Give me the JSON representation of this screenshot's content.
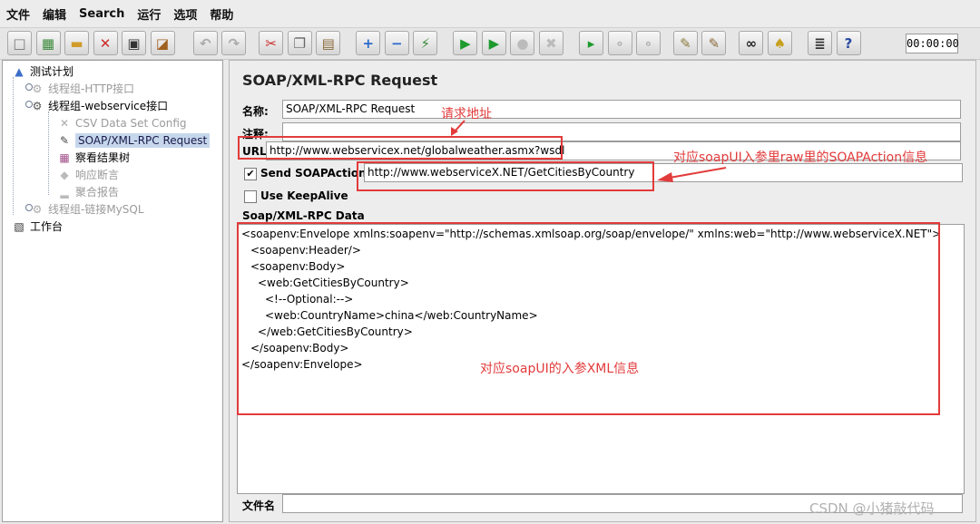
{
  "menu": [
    "文件",
    "编辑",
    "Search",
    "运行",
    "选项",
    "帮助"
  ],
  "toolbar": {
    "timer": "00:00:00",
    "buttons": [
      {
        "icon": "new-icon",
        "glyph": "□",
        "color": "#777"
      },
      {
        "icon": "templates-icon",
        "glyph": "▦",
        "color": "#3b8a3b"
      },
      {
        "icon": "open-icon",
        "glyph": "▬",
        "color": "#d19b2a"
      },
      {
        "icon": "close-file-icon",
        "glyph": "✕",
        "color": "#cc2a2a"
      },
      {
        "icon": "save-icon",
        "glyph": "▣",
        "color": "#333"
      },
      {
        "icon": "save-as-icon",
        "glyph": "◪",
        "color": "#a06020"
      },
      {
        "icon": "undo-icon",
        "glyph": "↶",
        "color": "#aaa"
      },
      {
        "icon": "redo-icon",
        "glyph": "↷",
        "color": "#aaa"
      },
      {
        "icon": "cut-icon",
        "glyph": "✂",
        "color": "#cc2a2a"
      },
      {
        "icon": "copy-icon",
        "glyph": "❐",
        "color": "#666"
      },
      {
        "icon": "paste-icon",
        "glyph": "▤",
        "color": "#8a6a3a"
      },
      {
        "icon": "expand-icon",
        "glyph": "+",
        "color": "#2a6acc"
      },
      {
        "icon": "collapse-icon",
        "glyph": "−",
        "color": "#2a6acc"
      },
      {
        "icon": "toggle-icon",
        "glyph": "⚡",
        "color": "#3b8a3b"
      },
      {
        "icon": "start-icon",
        "glyph": "▶",
        "color": "#1e9a2e"
      },
      {
        "icon": "start-no-pause-icon",
        "glyph": "▶",
        "color": "#1e9a2e"
      },
      {
        "icon": "stop-icon",
        "glyph": "●",
        "color": "#bbb"
      },
      {
        "icon": "shutdown-icon",
        "glyph": "✖",
        "color": "#bbb"
      },
      {
        "icon": "remote-start-icon",
        "glyph": "▸",
        "color": "#1e9a2e"
      },
      {
        "icon": "remote-stop-icon",
        "glyph": "∘",
        "color": "#aaa"
      },
      {
        "icon": "remote-shutdown-icon",
        "glyph": "∘",
        "color": "#aaa"
      },
      {
        "icon": "clear-icon",
        "glyph": "✎",
        "color": "#8a7a3a"
      },
      {
        "icon": "clear-all-icon",
        "glyph": "✎",
        "color": "#8a6a3a"
      },
      {
        "icon": "search-icon",
        "glyph": "∞",
        "color": "#222"
      },
      {
        "icon": "reset-search-icon",
        "glyph": "♠",
        "color": "#c8a020"
      },
      {
        "icon": "function-helper-icon",
        "glyph": "≣",
        "color": "#333"
      },
      {
        "icon": "help-icon",
        "glyph": "?",
        "color": "#2a4aa0"
      }
    ]
  },
  "tree": {
    "nodes": [
      {
        "label": "测试计划",
        "icon": "test-plan-icon",
        "glyph": "▲",
        "color": "#3b6ec8",
        "dim": false,
        "selected": false
      },
      {
        "label": "线程组-HTTP接口",
        "icon": "thread-group-icon",
        "glyph": "⚙",
        "color": "#aaa",
        "dim": true,
        "selected": false
      },
      {
        "label": "线程组-webservice接口",
        "icon": "thread-group-icon",
        "glyph": "⚙",
        "color": "#555",
        "dim": false,
        "selected": false
      },
      {
        "label": "CSV Data Set Config",
        "icon": "config-tools-icon",
        "glyph": "✕",
        "color": "#aaa",
        "dim": true,
        "selected": false
      },
      {
        "label": "SOAP/XML-RPC Request",
        "icon": "soap-sampler-icon",
        "glyph": "✎",
        "color": "#444",
        "dim": false,
        "selected": true
      },
      {
        "label": "察看结果树",
        "icon": "results-tree-icon",
        "glyph": "▦",
        "color": "#a0508a",
        "dim": false,
        "selected": false
      },
      {
        "label": "响应断言",
        "icon": "assertion-icon",
        "glyph": "◆",
        "color": "#bbb",
        "dim": true,
        "selected": false
      },
      {
        "label": "聚合报告",
        "icon": "aggregate-report-icon",
        "glyph": "▂",
        "color": "#bbb",
        "dim": true,
        "selected": false
      },
      {
        "label": "线程组-链接MySQL",
        "icon": "thread-group-icon",
        "glyph": "⚙",
        "color": "#aaa",
        "dim": true,
        "selected": false
      },
      {
        "label": "工作台",
        "icon": "workbench-icon",
        "glyph": "▧",
        "color": "#333",
        "dim": false,
        "selected": false
      }
    ]
  },
  "panel": {
    "title": "SOAP/XML-RPC Request",
    "name_label": "名称:",
    "name_value": "SOAP/XML-RPC Request",
    "comment_label": "注释:",
    "comment_value": "",
    "url_label": "URL",
    "url_value": "http://www.webservicex.net/globalweather.asmx?wsdl",
    "send_soapaction_label": "Send SOAPAction:",
    "send_soapaction_checked": "✔",
    "soapaction_value": "http://www.webserviceX.NET/GetCitiesByCountry",
    "keepalive_label": "Use KeepAlive",
    "keepalive_checked": "",
    "data_label": "Soap/XML-RPC Data",
    "xml_lines": [
      "<soapenv:Envelope xmlns:soapenv=\"http://schemas.xmlsoap.org/soap/envelope/\" xmlns:web=\"http://www.webserviceX.NET\">",
      "<soapenv:Header/>",
      "<soapenv:Body>",
      "<web:GetCitiesByCountry>",
      "<!--Optional:-->",
      "<web:CountryName>china</web:CountryName>",
      "</web:GetCitiesByCountry>",
      "</soapenv:Body>",
      "</soapenv:Envelope>"
    ],
    "file_label": "文件名",
    "file_value": ""
  },
  "annotations": {
    "url_note": "请求地址",
    "soapaction_note": "对应soapUI入参里raw里的SOAPAction信息",
    "xml_note": "对应soapUI的入参XML信息",
    "color": "#e23b3b"
  },
  "watermark": "CSDN @小猪敲代码"
}
